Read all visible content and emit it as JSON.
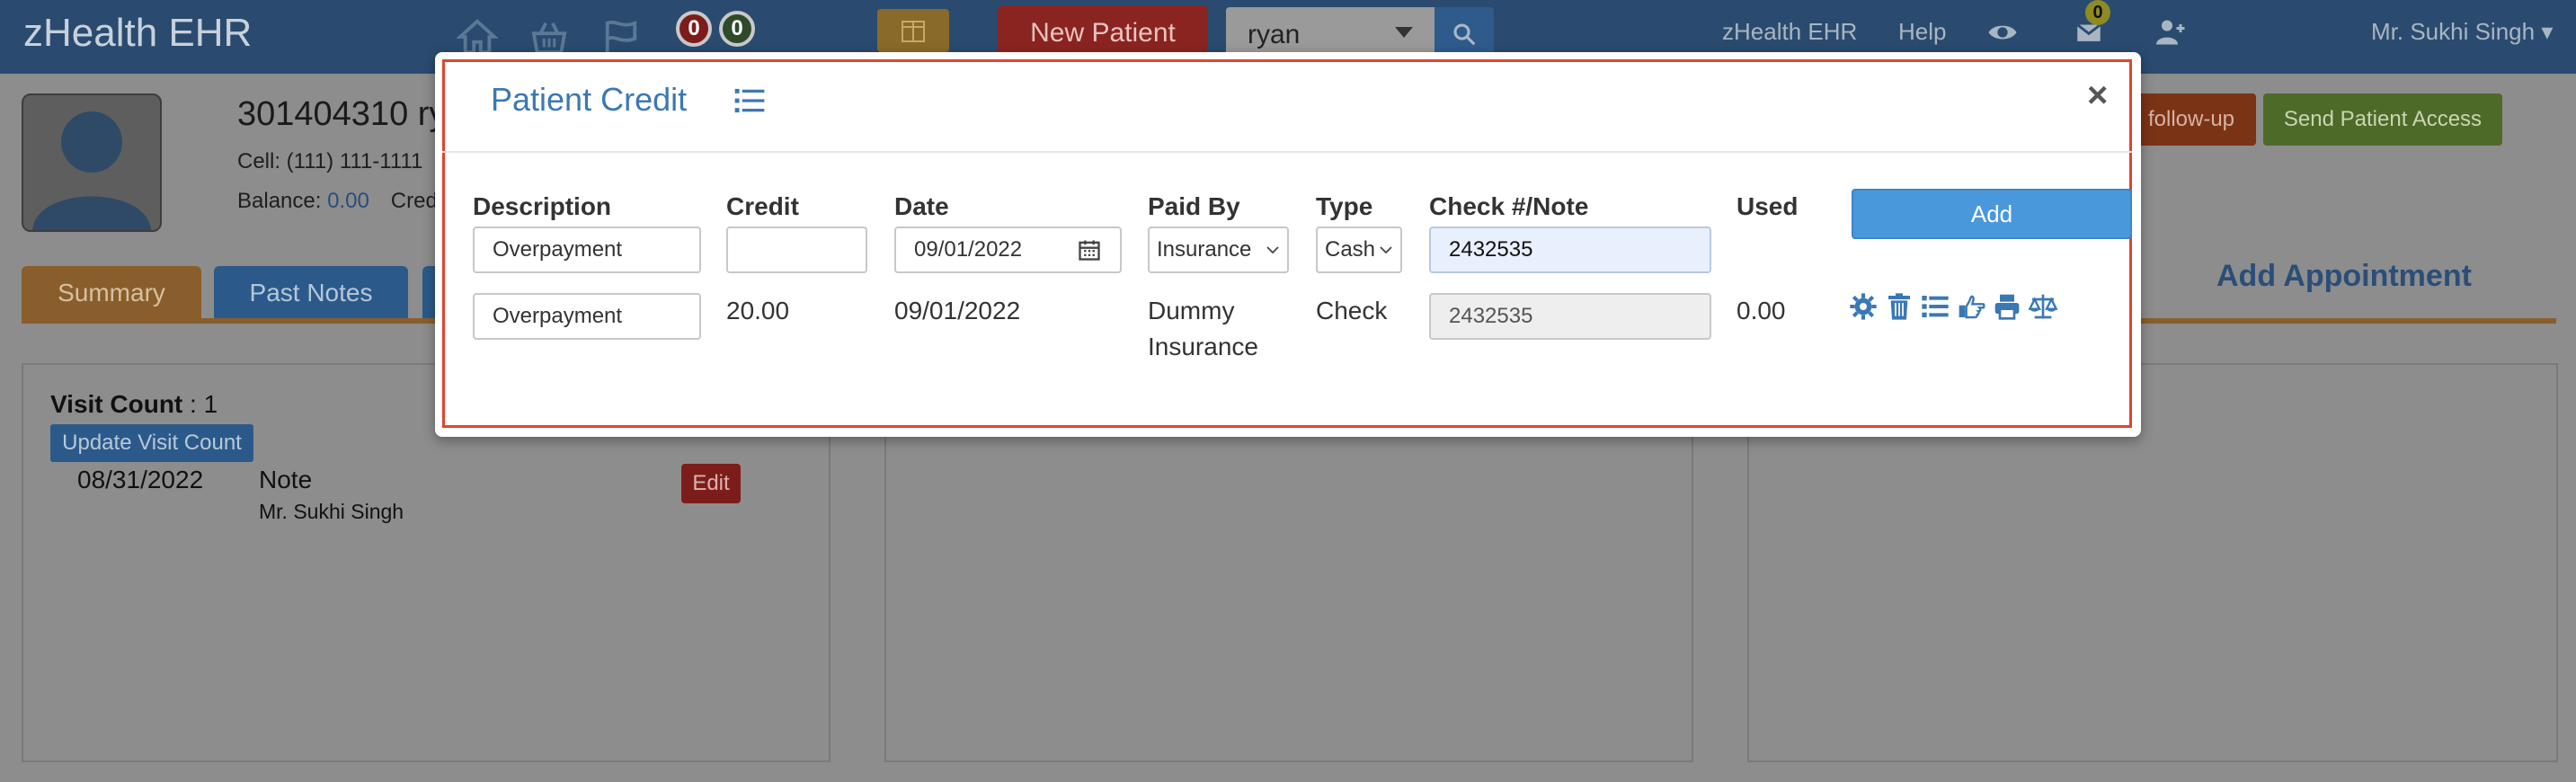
{
  "navbar": {
    "brand": "zHealth EHR",
    "badge_red": "0",
    "badge_green": "0",
    "new_patient_label": "New Patient",
    "search_value": "ryan",
    "link_ehr": "zHealth EHR",
    "link_help": "Help",
    "message_count": "0",
    "user_name": "Mr. Sukhi Singh",
    "icons": [
      "home-icon",
      "basket-icon",
      "flag-icon",
      "gift-icon",
      "search-icon",
      "eye-icon",
      "inbox-icon",
      "add-user-icon",
      "caret-down-icon"
    ]
  },
  "patient": {
    "name": "301404310 ry",
    "cell": "Cell: (111) 111-1111",
    "balance_label": "Balance: ",
    "balance_value": "0.00",
    "credit_label": "Credi"
  },
  "actions": {
    "followup_label": "follow-up",
    "send_access_label": "Send Patient Access"
  },
  "tabs": [
    {
      "label": "Summary",
      "active": true
    },
    {
      "label": "Past Notes",
      "active": false
    }
  ],
  "add_appointment_label": "Add Appointment",
  "visit_panel": {
    "visit_count_label": "Visit Count",
    "visit_count_value": " : 1",
    "update_button": "Update Visit Count",
    "entries": [
      {
        "date": "08/31/2022",
        "type": "Note",
        "by": "Mr. Sukhi Singh",
        "edit_label": "Edit"
      }
    ]
  },
  "modal": {
    "title": "Patient Credit",
    "close_glyph": "×",
    "columns": [
      "Description",
      "Credit",
      "Date",
      "Paid By",
      "Type",
      "Check #/Note",
      "Used"
    ],
    "form": {
      "description": "Overpayment",
      "credit": "",
      "date": "09/01/2022",
      "paid_by": "Insurance",
      "type": "Cash",
      "check_note": "2432535",
      "add_label": "Add"
    },
    "rows": [
      {
        "description": "Overpayment",
        "credit": "20.00",
        "date": "09/01/2022",
        "paid_by_line1": "Dummy",
        "paid_by_line2": "Insurance",
        "type": "Check",
        "check_note": "2432535",
        "used": "0.00",
        "action_icons": [
          "gear-icon",
          "trash-icon",
          "list-icon",
          "hand-pointer-icon",
          "print-icon",
          "balance-scale-icon"
        ]
      }
    ]
  },
  "colors": {
    "navbar": "#2a4b6f",
    "modal_title": "#3a78b5",
    "add_button": "#4a98dc",
    "highlight_frame": "#e1442c",
    "new_patient": "#8a2421"
  }
}
